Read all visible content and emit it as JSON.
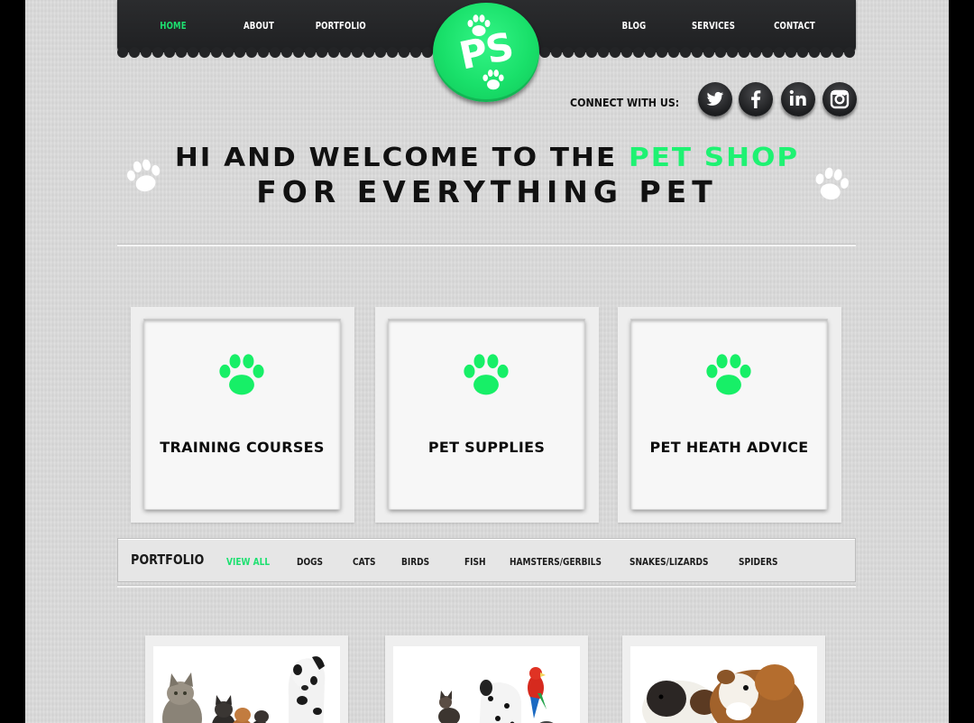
{
  "nav": {
    "items": [
      {
        "label": "HOME",
        "active": true
      },
      {
        "label": "ABOUT",
        "active": false
      },
      {
        "label": "PORTFOLIO",
        "active": false
      },
      {
        "label": "BLOG",
        "active": false
      },
      {
        "label": "SERVICES",
        "active": false
      },
      {
        "label": "CONTACT",
        "active": false
      }
    ]
  },
  "logo": {
    "text": "PS"
  },
  "connect": {
    "label": "CONNECT WITH US:",
    "icons": [
      "twitter-icon",
      "facebook-icon",
      "linkedin-icon",
      "instagram-icon"
    ]
  },
  "headline": {
    "line1_prefix": "HI AND WELCOME TO THE ",
    "line1_highlight": "PET SHOP",
    "line2": "FOR EVERYTHING PET"
  },
  "cards": [
    {
      "title": "TRAINING COURSES",
      "icon": "paw-icon"
    },
    {
      "title": "PET SUPPLIES",
      "icon": "paw-icon"
    },
    {
      "title": "PET HEATH ADVICE",
      "icon": "paw-icon"
    }
  ],
  "portfolio": {
    "title": "PORTFOLIO",
    "filters": [
      {
        "label": "VIEW ALL",
        "active": true
      },
      {
        "label": "DOGS",
        "active": false
      },
      {
        "label": "CATS",
        "active": false
      },
      {
        "label": "BIRDS",
        "active": false
      },
      {
        "label": "FISH",
        "active": false
      },
      {
        "label": "HAMSTERS/GERBILS",
        "active": false
      },
      {
        "label": "SNAKES/LIZARDS",
        "active": false
      },
      {
        "label": "SPIDERS",
        "active": false
      }
    ]
  },
  "colors": {
    "accent": "#1de070",
    "nav_bg": "#252628",
    "page_bg": "#dcdcdc",
    "text_dark": "#111111"
  }
}
